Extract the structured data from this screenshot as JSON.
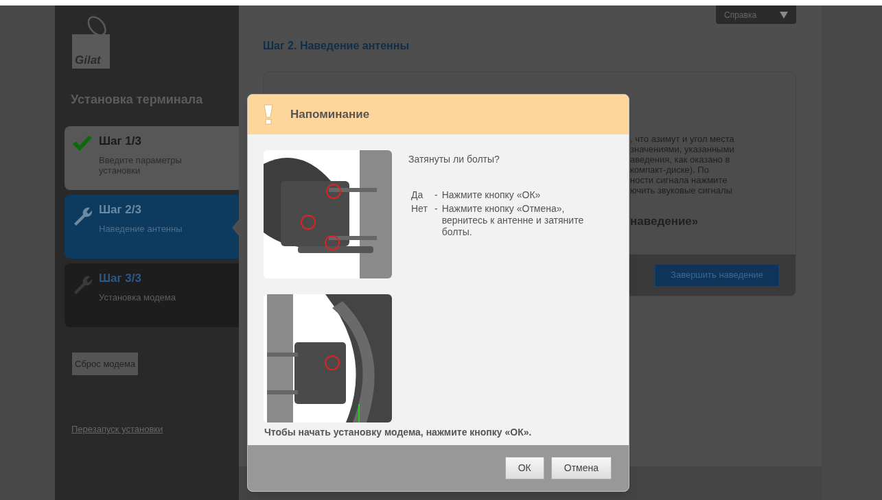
{
  "help_menu": {
    "label": "Справка"
  },
  "sidebar": {
    "logo": "Gilat",
    "title": "Установка терминала",
    "steps": [
      {
        "title": "Шаг 1/3",
        "subtitle": "Введите параметры установки",
        "kind": "done",
        "selected": false
      },
      {
        "title": "Шаг 2/3",
        "subtitle": "Наведение антенны",
        "kind": "current",
        "selected": true
      },
      {
        "title": "Шаг 3/3",
        "subtitle": "Установка модема",
        "kind": "pending",
        "selected": false
      }
    ],
    "reset_button": "Сброс модема",
    "restart_link": "Перезапуск установки"
  },
  "main": {
    "heading": "Шаг 2. Наведение антенны",
    "instruction_lines": [
      ", что азимут и угол места",
      "значениями, указанными",
      "аведения, как оказано в",
      "компакт-диске). По",
      "ности сигнала нажмите",
      "ючить звуковые сигналы"
    ],
    "subheading": "наведение»",
    "finish_button": "Завершить наведение"
  },
  "dialog": {
    "title": "Напоминание",
    "question": "Затянуты ли болты?",
    "answers": [
      {
        "label": "Да",
        "dash": "-",
        "text": "Нажмите кнопку «ОК»"
      },
      {
        "label": "Нет",
        "dash": "-",
        "text": "Нажмите кнопку «Отмена», вернитесь к антенне и затяните болты."
      }
    ],
    "footer_note": "Чтобы начать установку модема, нажмите кнопку «ОК».",
    "buttons": [
      "ОК",
      "Отмена"
    ]
  }
}
